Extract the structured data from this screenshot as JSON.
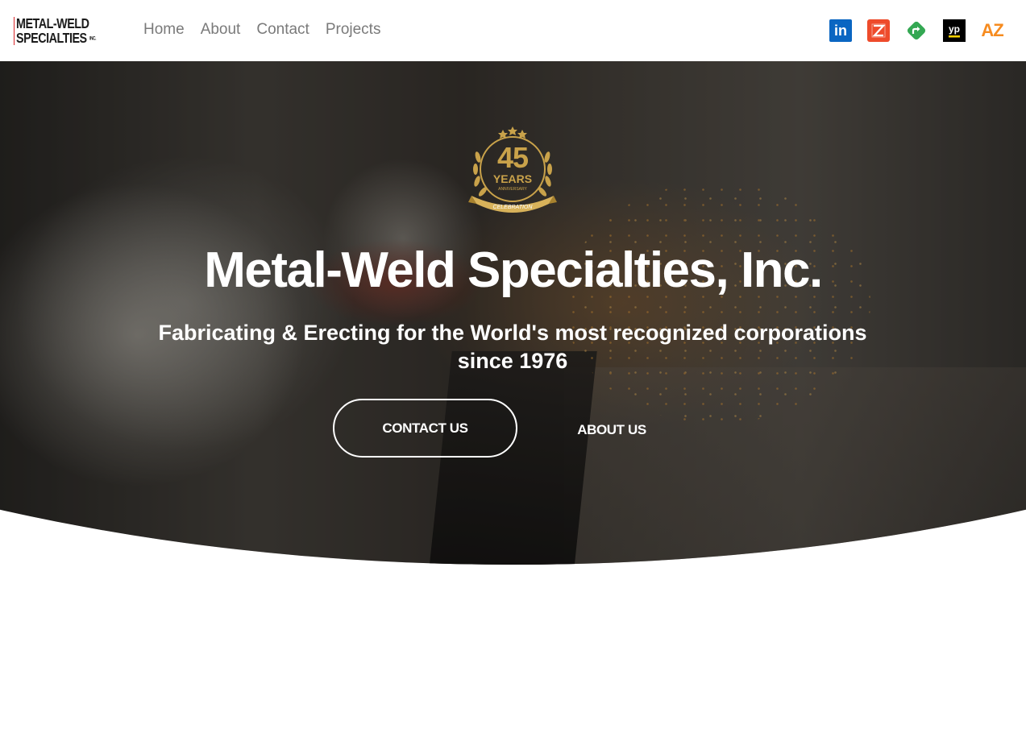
{
  "header": {
    "logo": {
      "line1": "METAL-WELD",
      "line2": "SPECIALTIES",
      "inc": "INC."
    },
    "nav": [
      {
        "label": "Home"
      },
      {
        "label": "About"
      },
      {
        "label": "Contact"
      },
      {
        "label": "Projects"
      }
    ],
    "social": [
      {
        "icon": "linkedin-icon",
        "glyph": "in",
        "color": "#0a66c2"
      },
      {
        "icon": "ziprecruiter-icon",
        "color": "#ee4b2b"
      },
      {
        "icon": "directions-icon",
        "color": "#34a853"
      },
      {
        "icon": "yellowpages-icon",
        "glyph": "yp",
        "color": "#000000"
      },
      {
        "icon": "az-icon",
        "glyph": "AZ",
        "color": "#f68b1f"
      }
    ]
  },
  "hero": {
    "badge": {
      "number": "45",
      "years": "YEARS",
      "anniversary": "ANNIVERSARY",
      "ribbon": "CELEBRATION",
      "gold": "#c9a24a"
    },
    "title": "Metal-Weld Specialties, Inc.",
    "subtitle": "Fabricating & Erecting for the World's most recognized corporations since 1976",
    "buttons": {
      "contact": "CONTACT US",
      "about": "ABOUT US"
    }
  }
}
